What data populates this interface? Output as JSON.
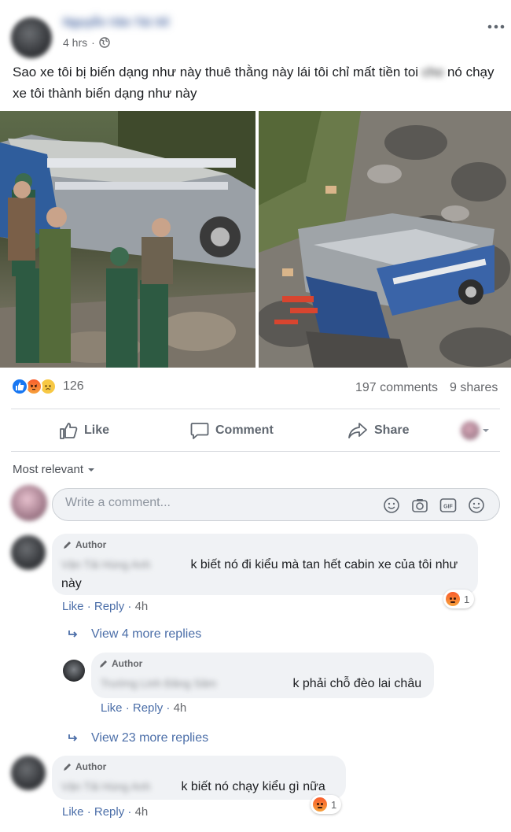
{
  "post": {
    "author_name": "Nguyễn Văn Tài Xế",
    "time": "4 hrs",
    "privacy_icon": "globe-icon",
    "text": "Sao xe tôi bị biến dạng như này thuê thằng này lái tôi chỉ mất tiền toi",
    "text_blurred": "cho",
    "text_end": "nó chạy xe tôi thành biến dạng như này",
    "more_icon": "ellipsis-icon"
  },
  "reactions": {
    "icons": [
      "like-icon",
      "angry-icon",
      "sad-icon"
    ],
    "count": "126",
    "comments": "197 comments",
    "shares": "9 shares"
  },
  "actions": {
    "like": "Like",
    "comment": "Comment",
    "share": "Share"
  },
  "filter": {
    "label": "Most relevant"
  },
  "composer": {
    "placeholder": "Write a comment...",
    "icons": [
      "emoji-icon",
      "camera-icon",
      "gif-icon",
      "sticker-icon"
    ]
  },
  "comments": [
    {
      "author_tag": "Author",
      "name": "Vận Tải Hùng Anh",
      "text": "k biết nó đi kiểu mà tan hết cabin xe của tôi như này",
      "like": "Like",
      "reply": "Reply",
      "time": "4h",
      "reaction_count": "1",
      "view_more": "View 4 more replies"
    },
    {
      "author_tag": "Author",
      "name": "Trường Linh Đăng Sâm",
      "text": "k phải chỗ đèo lai châu",
      "like": "Like",
      "reply": "Reply",
      "time": "4h",
      "view_more": "View 23 more replies"
    },
    {
      "author_tag": "Author",
      "name": "Vận Tải Hùng Anh",
      "text": "k biết nó chạy kiểu gì nữa",
      "like": "Like",
      "reply": "Reply",
      "time": "4h",
      "reaction_count": "1"
    }
  ],
  "colors": {
    "link": "#4b6ea8",
    "secondary_text": "#65676b",
    "like_blue": "#1877f2",
    "angry_orange": "#f7713b",
    "bubble_bg": "#f0f2f5"
  }
}
